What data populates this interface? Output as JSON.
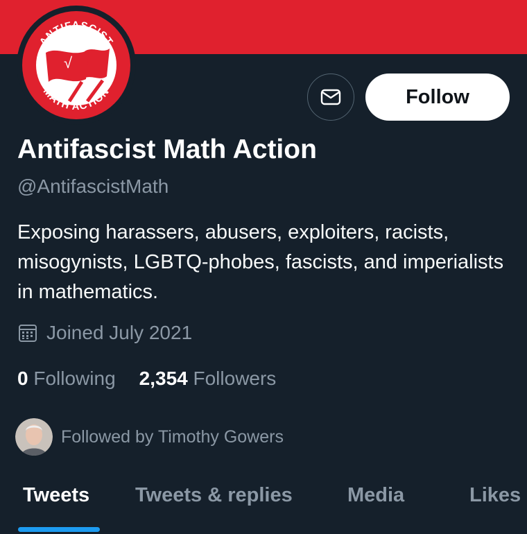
{
  "profile": {
    "name": "Antifascist Math Action",
    "handle": "@AntifascistMath",
    "bio": "Exposing harassers, abusers, exploiters, racists, misogynists, LGBTQ-phobes, fascists, and imperialists in mathematics.",
    "joined": "Joined July 2021",
    "avatar_text_top": "ANTIFASCIST",
    "avatar_text_bottom": "MATH ACTION",
    "avatar_symbol": "√"
  },
  "actions": {
    "message_icon": "envelope-icon",
    "follow_label": "Follow"
  },
  "stats": {
    "following_count": "0",
    "following_label": "Following",
    "followers_count": "2,354",
    "followers_label": "Followers"
  },
  "followed_by": {
    "text": "Followed by Timothy Gowers"
  },
  "tabs": [
    {
      "label": "Tweets",
      "active": true
    },
    {
      "label": "Tweets & replies",
      "active": false
    },
    {
      "label": "Media",
      "active": false
    },
    {
      "label": "Likes",
      "active": false
    }
  ],
  "colors": {
    "banner": "#e0212e",
    "background": "#15202b",
    "secondary_text": "#8b98a5",
    "accent": "#1d9bf0"
  }
}
